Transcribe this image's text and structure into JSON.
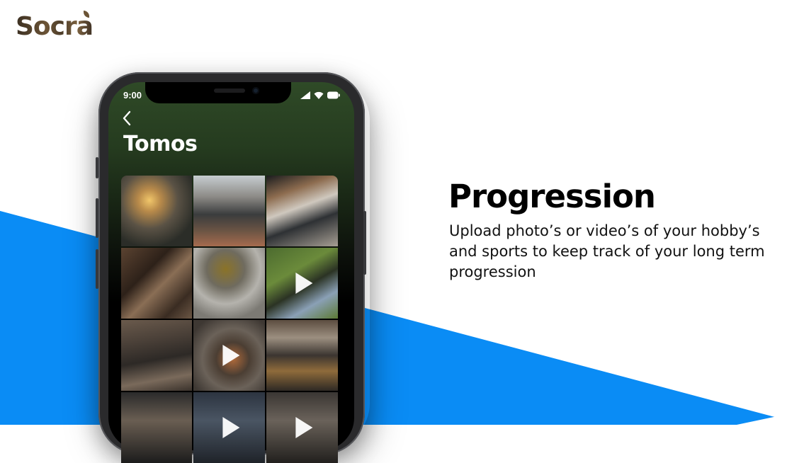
{
  "brand": {
    "logo_text": "Socra",
    "colors": {
      "blue": "#0a8cf5",
      "logo_brown": "#5a4630"
    }
  },
  "phone": {
    "status_bar": {
      "time": "9:00",
      "icons": [
        "signal-icon",
        "wifi-icon",
        "battery-icon"
      ]
    },
    "nav": {
      "back_icon": "chevron-left-icon",
      "title": "Tomos"
    },
    "media_grid": [
      {
        "kind": "photo"
      },
      {
        "kind": "photo"
      },
      {
        "kind": "photo"
      },
      {
        "kind": "photo"
      },
      {
        "kind": "photo"
      },
      {
        "kind": "video"
      },
      {
        "kind": "photo"
      },
      {
        "kind": "video"
      },
      {
        "kind": "photo"
      },
      {
        "kind": "photo"
      },
      {
        "kind": "video"
      },
      {
        "kind": "video"
      }
    ]
  },
  "feature": {
    "heading": "Progression",
    "description": "Upload photo’s or video’s of your hobby’s and sports to keep track of your long term progression"
  }
}
